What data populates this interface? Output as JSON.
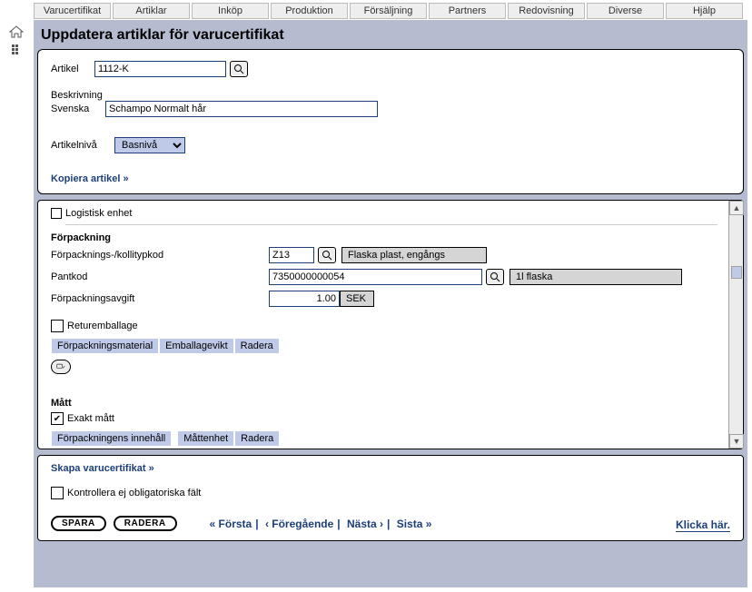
{
  "menu": [
    "Varucertifikat",
    "Artiklar",
    "Inköp",
    "Produktion",
    "Försäljning",
    "Partners",
    "Redovisning",
    "Diverse",
    "Hjälp"
  ],
  "title": "Uppdatera artiklar för varucertifikat",
  "article": {
    "label": "Artikel",
    "value": "1112-K",
    "desc_label": "Beskrivning",
    "lang_label": "Svenska",
    "desc_value": "Schampo Normalt hår",
    "level_label": "Artikelnivå",
    "level_value": "Basnivå",
    "copy_link": "Kopiera artikel »"
  },
  "mid": {
    "log_unit": "Logistisk enhet",
    "pack_heading": "Förpackning",
    "packtype_label": "Förpacknings-/kollitypkod",
    "packtype_code": "Z13",
    "packtype_text": "Flaska plast, engångs",
    "pantkod_label": "Pantkod",
    "pantkod_value": "7350000000054",
    "pantkod_text": "1l flaska",
    "fee_label": "Förpackningsavgift",
    "fee_value": "1.00",
    "fee_unit": "SEK",
    "return_label": "Returemballage",
    "cols1": [
      "Förpackningsmaterial",
      "Emballagevikt",
      "Radera"
    ],
    "meas_heading": "Mått",
    "exact_label": "Exakt mått",
    "cols2": [
      "Förpackningens innehåll",
      "Måttenhet",
      "Radera"
    ]
  },
  "bottom": {
    "create_link": "Skapa varucertifikat »",
    "noverify_label": "Kontrollera ej obligatoriska fält",
    "save": "SPARA",
    "delete": "RADERA",
    "pager": {
      "first": "« Första",
      "prev": "‹ Föregående",
      "next": "Nästa ›",
      "last": "Sista »"
    },
    "klicka": "Klicka här."
  }
}
